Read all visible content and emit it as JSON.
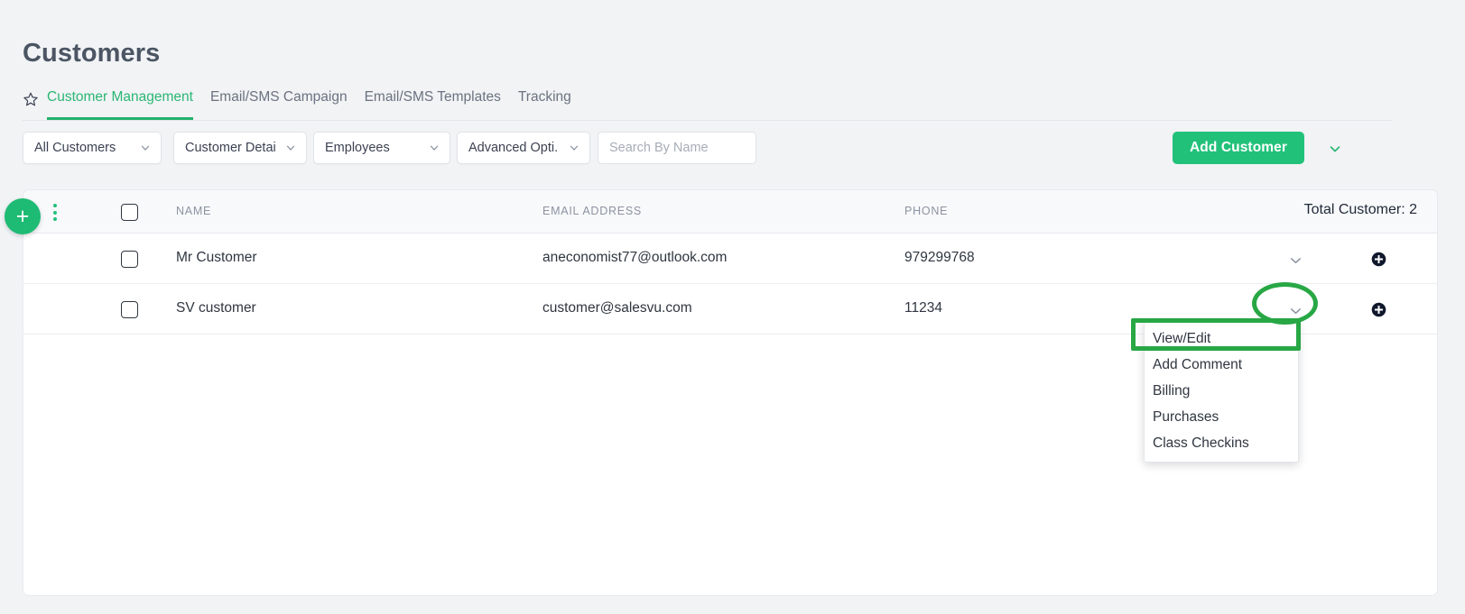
{
  "page": {
    "title": "Customers",
    "background_color": "#f1f3f5",
    "accent_color": "#22c17a",
    "annotation_color": "#28a745"
  },
  "tabs": {
    "star_icon": "star-icon",
    "items": [
      {
        "label": "Customer Management",
        "active": true
      },
      {
        "label": "Email/SMS Campaign",
        "active": false
      },
      {
        "label": "Email/SMS Templates",
        "active": false
      },
      {
        "label": "Tracking",
        "active": false
      }
    ]
  },
  "filters": {
    "all_customers": {
      "value": "All Customers",
      "icon": "chevron-down-icon"
    },
    "customer_detail": {
      "value": "Customer Detail",
      "icon": "chevron-down-icon"
    },
    "employees": {
      "value": "Employees",
      "icon": "chevron-down-icon"
    },
    "advanced_options": {
      "value": "Advanced Opti...",
      "icon": "chevron-down-icon"
    },
    "search": {
      "value": "",
      "placeholder": "Search By Name",
      "icon": "search-input"
    }
  },
  "actions": {
    "add_customer_label": "Add Customer",
    "add_customer_caret_icon": "chevron-down-icon",
    "fab_label": "+",
    "kebab_icon": "vertical-dots-icon"
  },
  "table": {
    "columns": {
      "name": "NAME",
      "email": "EMAIL ADDRESS",
      "phone": "PHONE"
    },
    "total_customer": "Total Customer: 2",
    "row_caret_icon": "chevron-down-icon",
    "row_add_icon": "plus-circle-icon",
    "rows": [
      {
        "name": "Mr Customer",
        "email": "aneconomist77@outlook.com",
        "phone": "979299768"
      },
      {
        "name": "SV customer",
        "email": "customer@salesvu.com",
        "phone": "11234"
      }
    ]
  },
  "context_menu": {
    "items": [
      {
        "label": "View/Edit",
        "highlighted": true
      },
      {
        "label": "Add Comment",
        "highlighted": false
      },
      {
        "label": "Billing",
        "highlighted": false
      },
      {
        "label": "Purchases",
        "highlighted": false
      },
      {
        "label": "Class Checkins",
        "highlighted": false
      }
    ]
  }
}
